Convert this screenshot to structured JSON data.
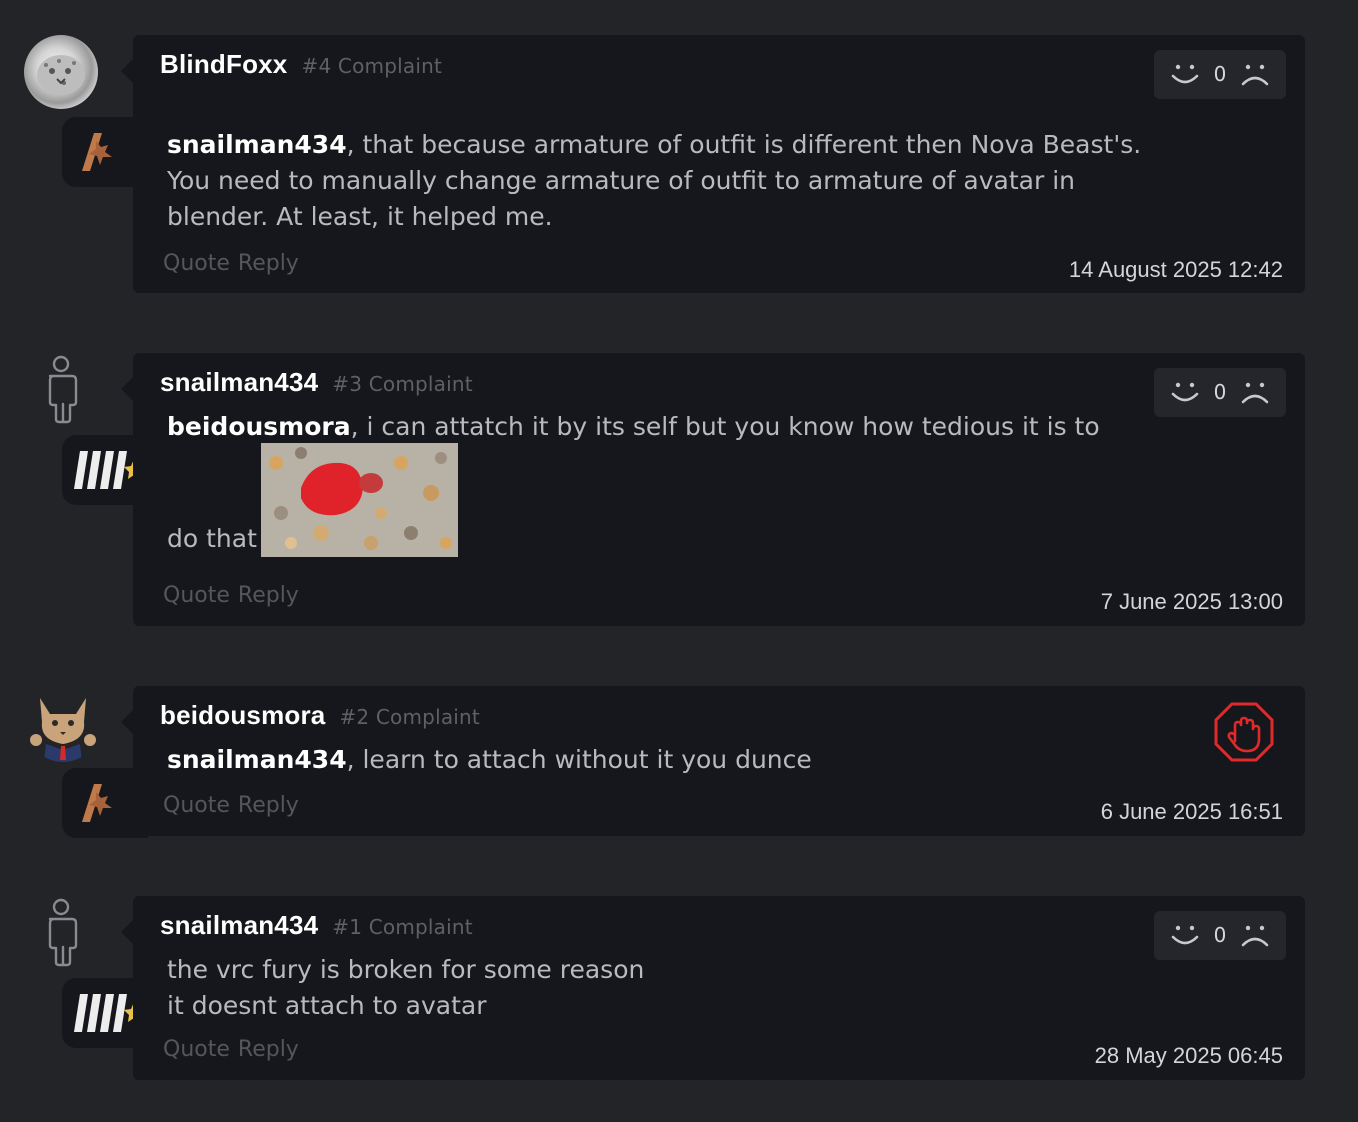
{
  "posts": [
    {
      "author": "BlindFoxx",
      "number": "#4 Complaint",
      "mention": "snailman434",
      "text": ", that because armature of outfit is different then Nova Beast's. You need to manually change armature of outfit to armature of avatar in blender. At least, it helped me.",
      "quote": "Quote",
      "reply": "Reply",
      "date": "14 August 2025 12:42",
      "reactions": {
        "count": "0",
        "like_icon": "smile-icon",
        "dislike_icon": "frown-icon"
      },
      "avatar": "snow-leopard-avatar",
      "rank_icon": "bronze-rank-badge-icon"
    },
    {
      "author": "snailman434",
      "number": "#3 Complaint",
      "mention": "beidousmora",
      "text": ", i can attatch it by its self but you know how tedious it is to",
      "text2": "do that",
      "quote": "Quote",
      "reply": "Reply",
      "date": "7 June 2025 13:00",
      "reactions": {
        "count": "0",
        "like_icon": "smile-icon",
        "dislike_icon": "frown-icon"
      },
      "avatar": "default-person-avatar",
      "rank_icon": "silver-rank-badge-icon",
      "image": "red-object-on-pebbles-image"
    },
    {
      "author": "beidousmora",
      "number": "#2 Complaint",
      "mention": "snailman434",
      "text": ", learn to attach without it you dunce",
      "quote": "Quote",
      "reply": "Reply",
      "date": "6 June 2025 16:51",
      "status_icon": "stop-hand-icon",
      "avatar": "fox-character-avatar",
      "rank_icon": "bronze-rank-badge-icon"
    },
    {
      "author": "snailman434",
      "number": "#1 Complaint",
      "line1": "the vrc fury is broken for some reason",
      "line2": "it doesnt attach to avatar",
      "quote": "Quote",
      "reply": "Reply",
      "date": "28 May 2025 06:45",
      "reactions": {
        "count": "0",
        "like_icon": "smile-icon",
        "dislike_icon": "frown-icon"
      },
      "avatar": "default-person-avatar",
      "rank_icon": "silver-rank-badge-icon"
    }
  ],
  "colors": {
    "background": "#232428",
    "card": "#16171c",
    "stop_red": "#e02a2a",
    "bronze": "#c07a4a",
    "gold_star": "#e8c04a"
  }
}
